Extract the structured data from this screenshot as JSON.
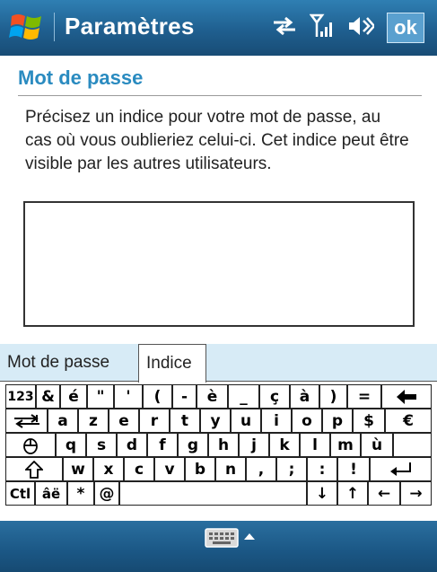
{
  "titlebar": {
    "title": "Paramètres",
    "ok_label": "ok"
  },
  "section": {
    "title": "Mot de passe"
  },
  "description": "Précisez un indice pour votre mot de passe, au cas où vous oublieriez celui-ci. Cet indice peut être visible par les autres utilisateurs.",
  "hint_input": {
    "value": ""
  },
  "tabs": [
    {
      "label": "Mot de passe",
      "selected": false
    },
    {
      "label": "Indice",
      "selected": true
    }
  ],
  "keyboard": {
    "row1": [
      "123",
      "&",
      "é",
      "\"",
      "'",
      "(",
      "-",
      "è",
      "_",
      "ç",
      "à",
      ")",
      "=",
      "🡄"
    ],
    "row2": [
      "⭾",
      "a",
      "z",
      "e",
      "r",
      "t",
      "y",
      "u",
      "i",
      "o",
      "p",
      "$",
      "€"
    ],
    "row3": [
      "⇪",
      "q",
      "s",
      "d",
      "f",
      "g",
      "h",
      "j",
      "k",
      "l",
      "m",
      "ù"
    ],
    "row4": [
      "⇧",
      "w",
      "x",
      "c",
      "v",
      "b",
      "n",
      ",",
      ";",
      ":",
      "!",
      "↵"
    ],
    "row5": [
      "Ctl",
      "âë",
      "*",
      "@",
      "",
      "↓",
      "↑",
      "←",
      "→"
    ]
  },
  "colors": {
    "accent": "#2a8bc0",
    "titlebar": "#1f5f8f",
    "tab_bg": "#d7ebf6"
  }
}
